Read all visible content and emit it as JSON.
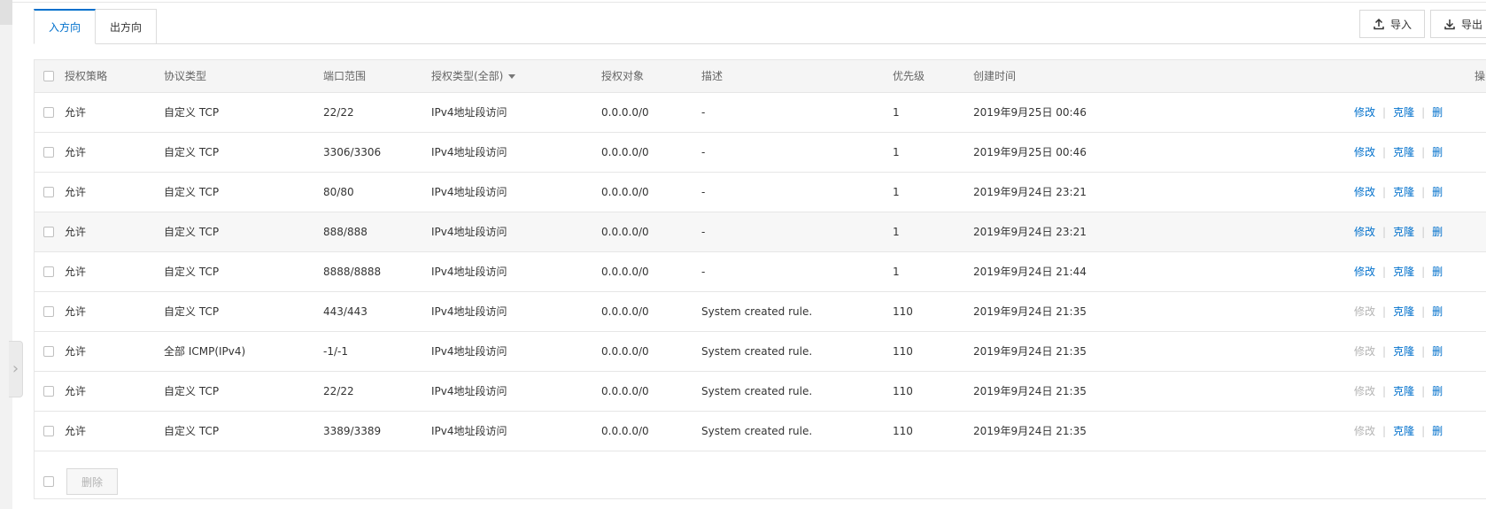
{
  "tabs": [
    {
      "label": "入方向",
      "active": true
    },
    {
      "label": "出方向",
      "active": false
    }
  ],
  "toolbar": {
    "import_label": "导入",
    "export_label": "导出"
  },
  "table": {
    "headers": {
      "policy": "授权策略",
      "protocol": "协议类型",
      "port": "端口范围",
      "auth_type": "授权类型(全部)",
      "target": "授权对象",
      "desc": "描述",
      "priority": "优先级",
      "created": "创建时间",
      "ops": "操"
    },
    "rows": [
      {
        "policy": "允许",
        "protocol": "自定义 TCP",
        "port": "22/22",
        "auth_type": "IPv4地址段访问",
        "target": "0.0.0.0/0",
        "desc": "-",
        "priority": "1",
        "created": "2019年9月25日 00:46",
        "edit": "修改",
        "edit_enabled": true,
        "clone": "克隆",
        "del": "删"
      },
      {
        "policy": "允许",
        "protocol": "自定义 TCP",
        "port": "3306/3306",
        "auth_type": "IPv4地址段访问",
        "target": "0.0.0.0/0",
        "desc": "-",
        "priority": "1",
        "created": "2019年9月25日 00:46",
        "edit": "修改",
        "edit_enabled": true,
        "clone": "克隆",
        "del": "删"
      },
      {
        "policy": "允许",
        "protocol": "自定义 TCP",
        "port": "80/80",
        "auth_type": "IPv4地址段访问",
        "target": "0.0.0.0/0",
        "desc": "-",
        "priority": "1",
        "created": "2019年9月24日 23:21",
        "edit": "修改",
        "edit_enabled": true,
        "clone": "克隆",
        "del": "删"
      },
      {
        "policy": "允许",
        "protocol": "自定义 TCP",
        "port": "888/888",
        "auth_type": "IPv4地址段访问",
        "target": "0.0.0.0/0",
        "desc": "-",
        "priority": "1",
        "created": "2019年9月24日 23:21",
        "edit": "修改",
        "edit_enabled": true,
        "clone": "克隆",
        "del": "删"
      },
      {
        "policy": "允许",
        "protocol": "自定义 TCP",
        "port": "8888/8888",
        "auth_type": "IPv4地址段访问",
        "target": "0.0.0.0/0",
        "desc": "-",
        "priority": "1",
        "created": "2019年9月24日 21:44",
        "edit": "修改",
        "edit_enabled": true,
        "clone": "克隆",
        "del": "删"
      },
      {
        "policy": "允许",
        "protocol": "自定义 TCP",
        "port": "443/443",
        "auth_type": "IPv4地址段访问",
        "target": "0.0.0.0/0",
        "desc": "System created rule.",
        "priority": "110",
        "created": "2019年9月24日 21:35",
        "edit": "修改",
        "edit_enabled": false,
        "clone": "克隆",
        "del": "删"
      },
      {
        "policy": "允许",
        "protocol": "全部 ICMP(IPv4)",
        "port": "-1/-1",
        "auth_type": "IPv4地址段访问",
        "target": "0.0.0.0/0",
        "desc": "System created rule.",
        "priority": "110",
        "created": "2019年9月24日 21:35",
        "edit": "修改",
        "edit_enabled": false,
        "clone": "克隆",
        "del": "删"
      },
      {
        "policy": "允许",
        "protocol": "自定义 TCP",
        "port": "22/22",
        "auth_type": "IPv4地址段访问",
        "target": "0.0.0.0/0",
        "desc": "System created rule.",
        "priority": "110",
        "created": "2019年9月24日 21:35",
        "edit": "修改",
        "edit_enabled": false,
        "clone": "克隆",
        "del": "删"
      },
      {
        "policy": "允许",
        "protocol": "自定义 TCP",
        "port": "3389/3389",
        "auth_type": "IPv4地址段访问",
        "target": "0.0.0.0/0",
        "desc": "System created rule.",
        "priority": "110",
        "created": "2019年9月24日 21:35",
        "edit": "修改",
        "edit_enabled": false,
        "clone": "克隆",
        "del": "删"
      }
    ],
    "highlight_row": 3
  },
  "footer": {
    "delete_label": "删除"
  },
  "colors": {
    "accent": "#0070cc",
    "disabled": "#b3b3b3"
  }
}
